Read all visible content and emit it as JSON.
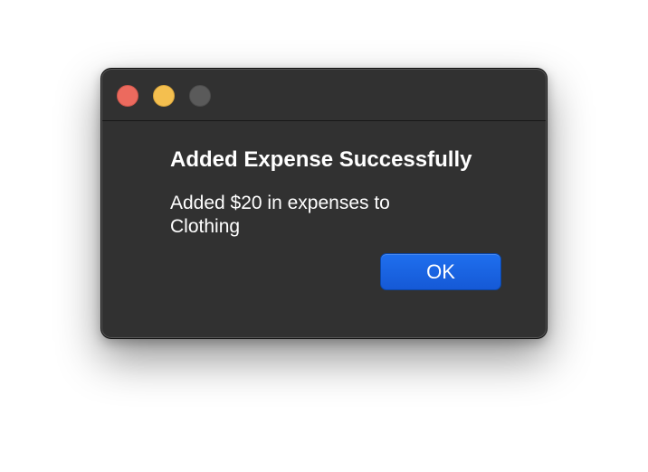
{
  "dialog": {
    "title": "Added Expense Successfully",
    "message": "Added $20 in expenses to Clothing",
    "ok_label": "OK"
  },
  "colors": {
    "window_background": "#313131",
    "button_accent": "#1c66e5",
    "close_light": "#ec6a5e",
    "minimize_light": "#f4bf4f",
    "zoom_light_disabled": "#5a5a5a"
  }
}
